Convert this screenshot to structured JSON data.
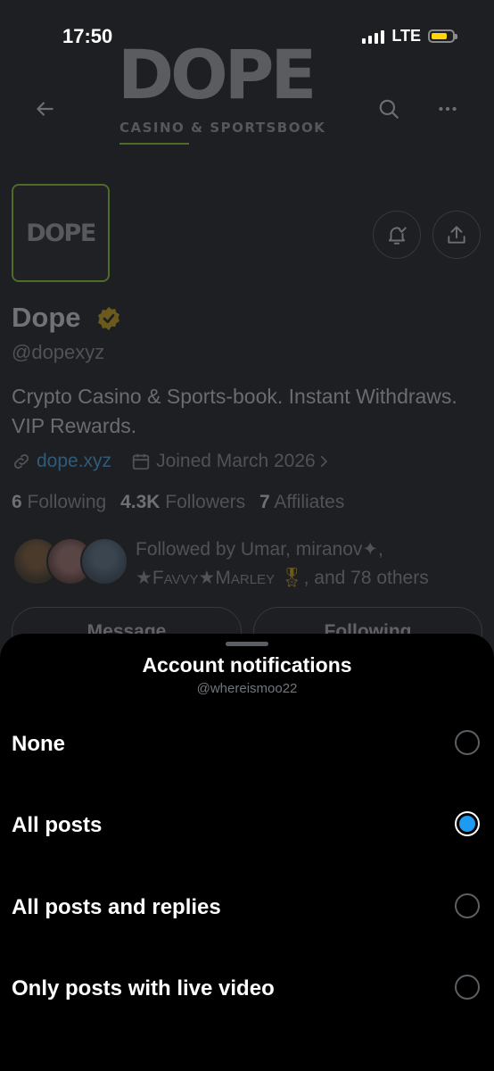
{
  "status_bar": {
    "time": "17:50",
    "network": "LTE",
    "battery_level": 0.75
  },
  "header": {
    "banner_title": "DOPE",
    "banner_subtitle": "CASINO & SPORTSBOOK",
    "back_icon": "arrow-left-icon",
    "search_icon": "search-icon",
    "more_icon": "more-icon"
  },
  "profile": {
    "avatar_text": "DOPE",
    "name": "Dope",
    "handle": "@dopexyz",
    "bio": "Crypto Casino & Sports-book. Instant Withdraws. VIP Rewards.",
    "website": "dope.xyz",
    "joined": "Joined March 2026",
    "following_count": "6",
    "following_label": "Following",
    "followers_count": "4.3K",
    "followers_label": "Followers",
    "affiliates_count": "7",
    "affiliates_label": "Affiliates",
    "followed_by_prefix": "Followed by Umar, miranov✦,",
    "followed_by_name": "★Favvy★Marley",
    "followed_by_suffix": ", and 78 others",
    "message_label": "Message",
    "following_button_label": "Following"
  },
  "sheet": {
    "title": "Account notifications",
    "subtitle": "@whereismoo22",
    "options": [
      {
        "label": "None",
        "selected": false
      },
      {
        "label": "All posts",
        "selected": true
      },
      {
        "label": "All posts and replies",
        "selected": false
      },
      {
        "label": "Only posts with live video",
        "selected": false
      }
    ]
  },
  "colors": {
    "accent": "#1d9bf0",
    "brand_border": "#4f6b28",
    "sheet_bg": "#000000"
  }
}
